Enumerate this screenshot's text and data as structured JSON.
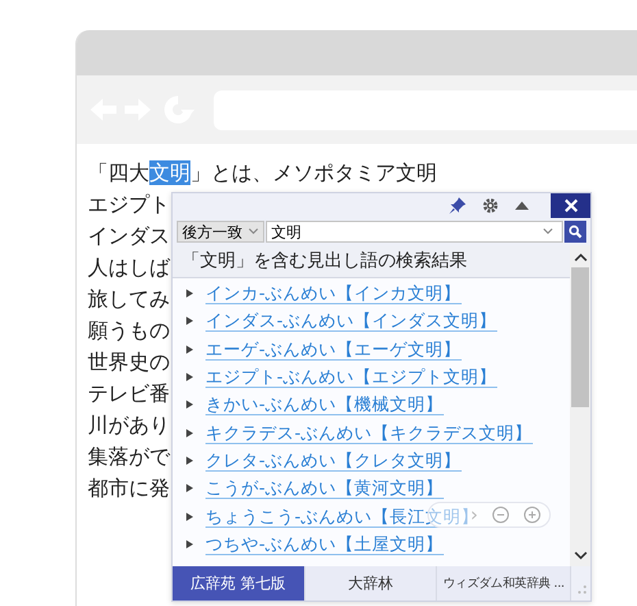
{
  "article": {
    "first_line": {
      "before": "「四大",
      "selected": "文明",
      "after": "」とは、メソポタミア文明"
    },
    "lines": [
      "エジプト",
      "インダス",
      "人はしば",
      "旅してみ",
      "願うもの",
      "世界史の",
      "テレビ番",
      "川があり",
      "集落がで",
      "都市に発"
    ]
  },
  "popup": {
    "match_mode": "後方一致",
    "query": "文明",
    "heading": "「文明」を含む見出し語の検索結果",
    "results": [
      {
        "label": "インカ-ぶんめい【インカ文明】"
      },
      {
        "label": "インダス-ぶんめい【インダス文明】"
      },
      {
        "label": "エーゲ-ぶんめい【エーゲ文明】"
      },
      {
        "label": "エジプト-ぶんめい【エジプト文明】"
      },
      {
        "label": "きかい-ぶんめい【機械文明】"
      },
      {
        "label": "キクラデス-ぶんめい【キクラデス文明】"
      },
      {
        "label": "クレタ-ぶんめい【クレタ文明】"
      },
      {
        "label": "こうが-ぶんめい【黄河文明】"
      },
      {
        "label": "ちょうこう-ぶんめい【長江文明】"
      },
      {
        "label": "つちや-ぶんめい【土屋文明】"
      }
    ],
    "zoom_controls": {
      "next": "›"
    },
    "tabs": [
      {
        "label": "広辞苑 第七版",
        "selected": true
      },
      {
        "label": "大辞林",
        "selected": false
      },
      {
        "label": "ウィズダム和英辞典 ...",
        "selected": false
      }
    ]
  }
}
